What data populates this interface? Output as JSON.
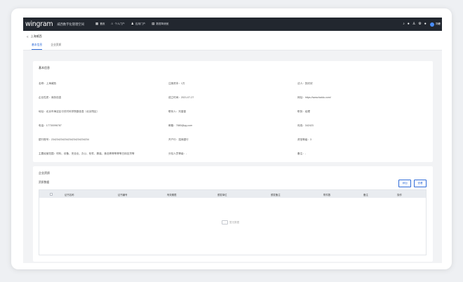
{
  "header": {
    "logo": "wingram",
    "system_name": "威西数字化管理空间",
    "nav": [
      {
        "icon": "grid-icon",
        "glyph": "▦",
        "label": "首页"
      },
      {
        "icon": "home-icon",
        "glyph": "⌂",
        "label": "个人门户"
      },
      {
        "icon": "user-icon",
        "glyph": "♟",
        "label": "应用门户"
      },
      {
        "icon": "dashboard-icon",
        "glyph": "▤",
        "label": "数据驾驶舱"
      }
    ],
    "tools": [
      {
        "icon": "bell-icon",
        "glyph": "♪"
      },
      {
        "icon": "chat-icon",
        "glyph": "●"
      },
      {
        "icon": "person-icon",
        "glyph": "♙"
      },
      {
        "icon": "gear-icon",
        "glyph": "⚙"
      },
      {
        "icon": "help-icon",
        "glyph": "●"
      }
    ],
    "user_name": "刘峰"
  },
  "breadcrumb": {
    "back": "<",
    "title": "上海威西"
  },
  "tabs": [
    {
      "label": "基本信息",
      "active": true
    },
    {
      "label": "企业资质",
      "active": false
    }
  ],
  "basic_info": {
    "title": "基本信息",
    "rows": [
      [
        {
          "label": "名称：",
          "value": "上海威西"
        },
        {
          "label": "注册资本：",
          "value": "1万"
        },
        {
          "label": "法人：",
          "value": "张欣欣"
        }
      ],
      [
        {
          "label": "企业性质：",
          "value": "商务信息"
        },
        {
          "label": "成立时间：",
          "value": "2021-07-27"
        },
        {
          "label": "网址：",
          "value": "https://www.baidu.com/"
        }
      ],
      [
        {
          "label": "地址：",
          "value": "北京市海淀区中关村科学院路信息（北京院区）"
        },
        {
          "label": "联系人：",
          "value": "刘香香"
        },
        {
          "label": "职务：",
          "value": "经理"
        }
      ],
      [
        {
          "label": "电话：",
          "value": "17730096787"
        },
        {
          "label": "邮箱：",
          "value": "7880@qq.com"
        },
        {
          "label": "传真：",
          "value": "342423"
        }
      ],
      [
        {
          "label": "银行账号：",
          "value": "234234234234234234234234234"
        },
        {
          "label": "开户行：",
          "value": "招商银行"
        },
        {
          "label": "资信等级：",
          "value": "3"
        }
      ],
      [
        {
          "label": "主要经营范围：",
          "value": "材料、设备、安全出、办公、软件、服装、食品等等等等等日用百货等"
        },
        {
          "label": "分包人员等级：",
          "value": "-"
        },
        {
          "label": "备注：",
          "value": "-"
        }
      ]
    ]
  },
  "qualification": {
    "title": "企业资质",
    "subtitle": "资质数据",
    "add_label": "添加",
    "view_label": "查看",
    "columns": [
      "证书名称",
      "证书编号",
      "有效期限",
      "颁发单位",
      "颁发备注",
      "附件数",
      "备注",
      "操作"
    ],
    "empty_text": "暂无数据"
  }
}
